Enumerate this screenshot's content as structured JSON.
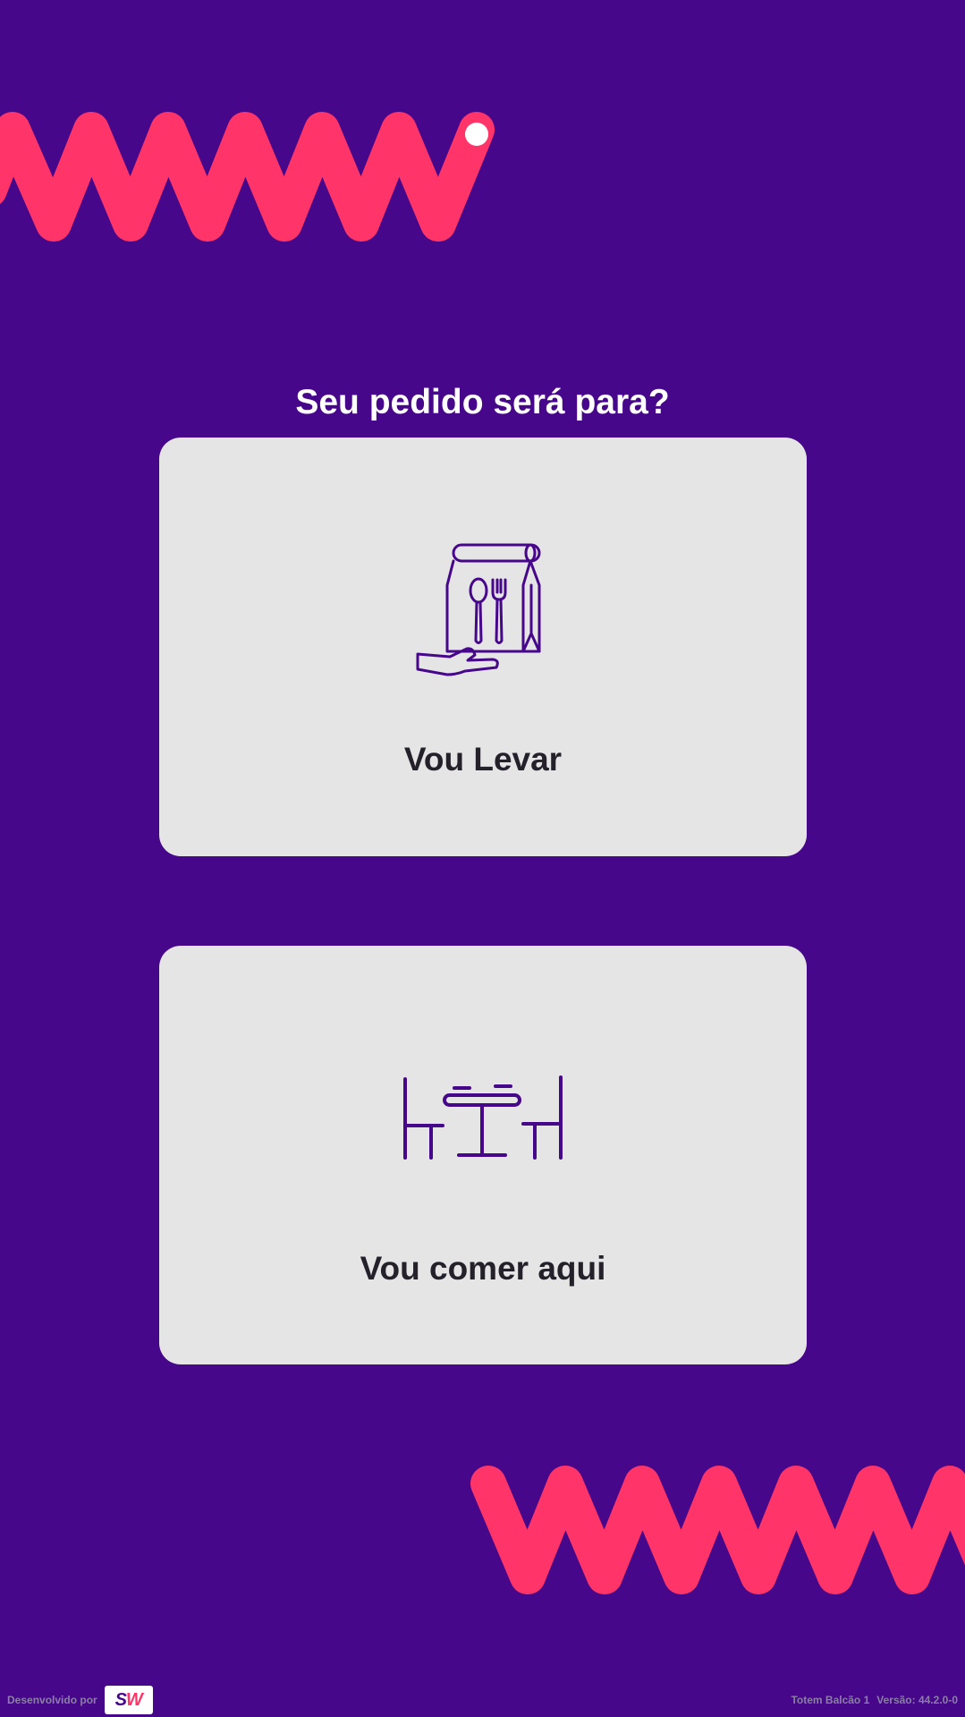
{
  "question": "Seu pedido será para?",
  "options": [
    {
      "label": "Vou Levar",
      "icon": "takeaway-bag-icon"
    },
    {
      "label": "Vou comer aqui",
      "icon": "table-chairs-icon"
    }
  ],
  "footer": {
    "developed_by": "Desenvolvido por",
    "logo_text": {
      "s": "S",
      "w": "W"
    },
    "device": "Totem Balcão 1",
    "version": "Versão: 44.2.0-0"
  },
  "colors": {
    "background": "#46078a",
    "accent": "#ff3468",
    "card": "#e6e5e6",
    "icon": "#46078a",
    "card_text": "#24212a"
  }
}
